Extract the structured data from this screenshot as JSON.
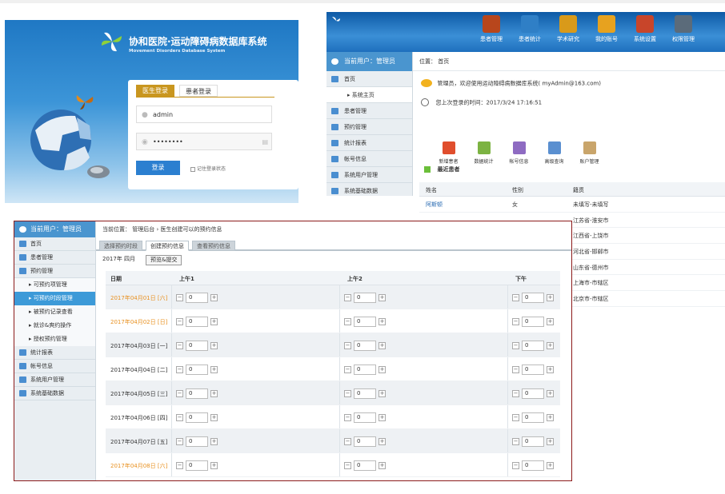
{
  "login": {
    "title": "协和医院·运动障碍病数据库系统",
    "subtitle": "Movement Disorders Database System",
    "tab_doctor": "医生登录",
    "tab_patient": "患者登录",
    "username": "admin",
    "password_mask": "••••••••",
    "login_button": "登录",
    "remember": "记住登录状态"
  },
  "dashboard": {
    "nav": [
      "患者管理",
      "患者统计",
      "学术研究",
      "我的账号",
      "系统设置",
      "权限管理"
    ],
    "nav_colors": [
      "#b8461c",
      "#2f7fc6",
      "#d99a1a",
      "#e7a21f",
      "#c8452a",
      "#5b6b7a"
    ],
    "current_user": "当前用户：管理员",
    "side": [
      "首页",
      "系统主页",
      "患者管理",
      "预约管理",
      "统计报表",
      "帐号信息",
      "系统用户管理",
      "系统基础数据"
    ],
    "position": "位置： 首页",
    "welcome": "管理员，欢迎使用运动障碍病数据库系统( myAdmin@163.com)",
    "last_login": "您上次登录的时间：2017/3/24 17:16:51",
    "quick": [
      "新增患者",
      "数据统计",
      "帐号信息",
      "高级查询",
      "账户管理"
    ],
    "recent": "最近患者",
    "table": {
      "headers": [
        "姓名",
        "性别",
        "籍贯"
      ],
      "rows": [
        [
          "阿斯顿",
          "女",
          "未填写-未填写"
        ],
        [
          "",
          "",
          "江苏省-淮安市"
        ],
        [
          "",
          "",
          "江西省-上饶市"
        ],
        [
          "",
          "",
          "河北省-邯郸市"
        ],
        [
          "",
          "",
          "山东省-德州市"
        ],
        [
          "",
          "",
          "上海市-市辖区"
        ],
        [
          "",
          "",
          "北京市-市辖区"
        ]
      ]
    }
  },
  "appt": {
    "current_user": "当前用户：管理员",
    "side": [
      "首页",
      "患者管理",
      "预约管理",
      "可预约项管理",
      "可预约时段管理",
      "被预约记录查看",
      "就诊&爽约操作",
      "授权预约管理",
      "统计报表",
      "帐号信息",
      "系统用户管理",
      "系统基础数据"
    ],
    "position": "当前位置： 管理后台 › 医生创建可以的预约信息",
    "tabs": [
      "选择预约时段",
      "创建预约信息",
      "查看预约信息"
    ],
    "month": "2017年 四月",
    "submit": "预览&提交",
    "headers": [
      "日期",
      "上午1",
      "上午2",
      "下午"
    ],
    "rows": [
      {
        "date": "2017年04月01日 [六]",
        "v": [
          "0",
          "0",
          "0"
        ],
        "weekend": true
      },
      {
        "date": "2017年04月02日 [日]",
        "v": [
          "0",
          "0",
          "0"
        ],
        "weekend": true
      },
      {
        "date": "2017年04月03日 [一]",
        "v": [
          "0",
          "0",
          "0"
        ],
        "weekend": false
      },
      {
        "date": "2017年04月04日 [二]",
        "v": [
          "0",
          "0",
          "0"
        ],
        "weekend": false
      },
      {
        "date": "2017年04月05日 [三]",
        "v": [
          "0",
          "0",
          "0"
        ],
        "weekend": false
      },
      {
        "date": "2017年04月06日 [四]",
        "v": [
          "0",
          "0",
          "0"
        ],
        "weekend": false
      },
      {
        "date": "2017年04月07日 [五]",
        "v": [
          "0",
          "0",
          "0"
        ],
        "weekend": false
      },
      {
        "date": "2017年04月08日 [六]",
        "v": [
          "0",
          "0",
          "0"
        ],
        "weekend": true
      }
    ],
    "minus": "−",
    "plus": "+"
  }
}
